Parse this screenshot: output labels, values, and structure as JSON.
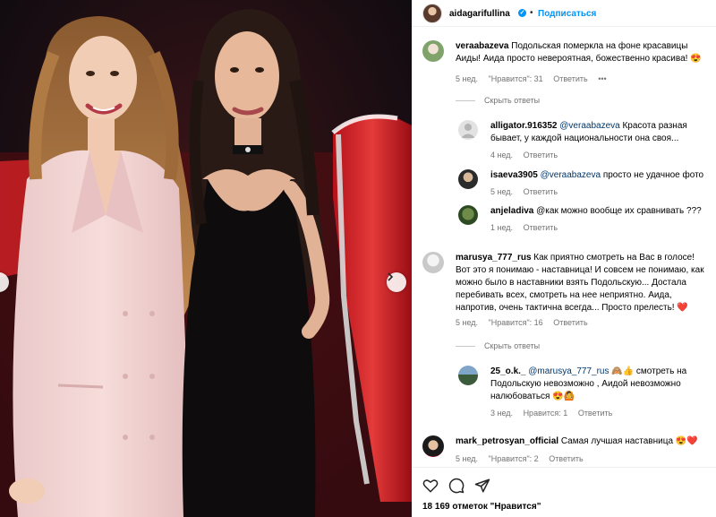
{
  "header": {
    "username": "aidagarifullina",
    "dot": "•",
    "follow_label": "Подписаться"
  },
  "comments": [
    {
      "user": "veraabazeva",
      "text": "Подольская померкла на фоне красавицы Аиды! Аида просто невероятная, божественно красива!",
      "emoji": "😍",
      "time": "5 нед.",
      "likes": "\"Нравится\": 31",
      "reply": "Ответить",
      "more": "•••",
      "hide_replies": "Скрыть ответы",
      "replies": [
        {
          "user": "alligator.916352",
          "mention": "@veraabazeva",
          "text": "Красота разная бывает, у каждой национальности она своя...",
          "time": "4 нед.",
          "reply": "Ответить"
        },
        {
          "user": "isaeva3905",
          "mention": "@veraabazeva",
          "text": "просто не удачное фото",
          "time": "5 нед.",
          "reply": "Ответить"
        },
        {
          "user": "anjeladiva",
          "mention": "",
          "text": "@как можно вообще их сравнивать ???",
          "time": "1 нед.",
          "reply": "Ответить"
        }
      ]
    },
    {
      "user": "marusya_777_rus",
      "text": "Как приятно смотреть на Вас в голосе! Вот это я понимаю - наставница! И совсем не понимаю, как можно было в наставники взять Подольскую... Достала перебивать всех, смотреть на нее неприятно. Аида, напротив, очень тактична всегда... Просто прелесть!",
      "emoji": "❤️",
      "time": "5 нед.",
      "likes": "\"Нравится\": 16",
      "reply": "Ответить",
      "hide_replies": "Скрыть ответы",
      "replies": [
        {
          "user": "25_o.k._",
          "mention": "@marusya_777_rus",
          "text": "🙈👍 смотреть на Подольскую невозможно , Аидой невозможно налюбоваться 😍🙆",
          "time": "3 нед.",
          "likes": "Нравится: 1",
          "reply": "Ответить"
        }
      ]
    },
    {
      "user": "mark_petrosyan_official",
      "text": "Самая лучшая наставница",
      "emoji": "😍❤️",
      "time": "5 нед.",
      "likes": "\"Нравится\": 2",
      "reply": "Ответить"
    }
  ],
  "footer": {
    "likes_text": "18 169 отметок \"Нравится\""
  },
  "colors": {
    "accent": "#0095f6",
    "mention": "#00376b",
    "meta": "#737373",
    "heart": "#e0245e"
  },
  "icons": [
    "chevron-right-icon",
    "verified-icon",
    "heart-outline-icon",
    "comment-icon",
    "share-icon"
  ]
}
